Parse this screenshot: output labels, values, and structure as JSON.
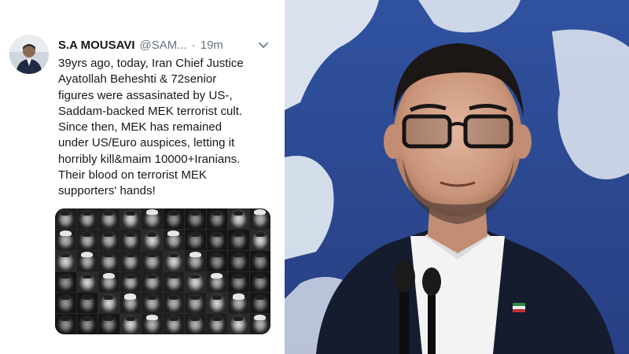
{
  "tweet": {
    "display_name": "S.A MOUSAVI",
    "handle": "@SAM...",
    "separator": "·",
    "time": "19m",
    "text_lines": [
      "39yrs ago, today, Iran Chief Justice",
      "Ayatollah Beheshti & 72senior",
      "figures were assasinated by US-,",
      "Saddam-backed MEK terrorist cult.",
      "Since then, MEK has remained",
      "under US/Euro auspices, letting it",
      "horribly kill&maim 10000+Iranians.",
      "Their blood on terrorist MEK",
      "supporters' hands!"
    ]
  },
  "icons": {
    "avatar": "avatar-photo",
    "menu": "chevron-down-icon"
  },
  "colors": {
    "name": "#14171a",
    "secondary": "#657786",
    "map_blue": "#3a5cae"
  }
}
